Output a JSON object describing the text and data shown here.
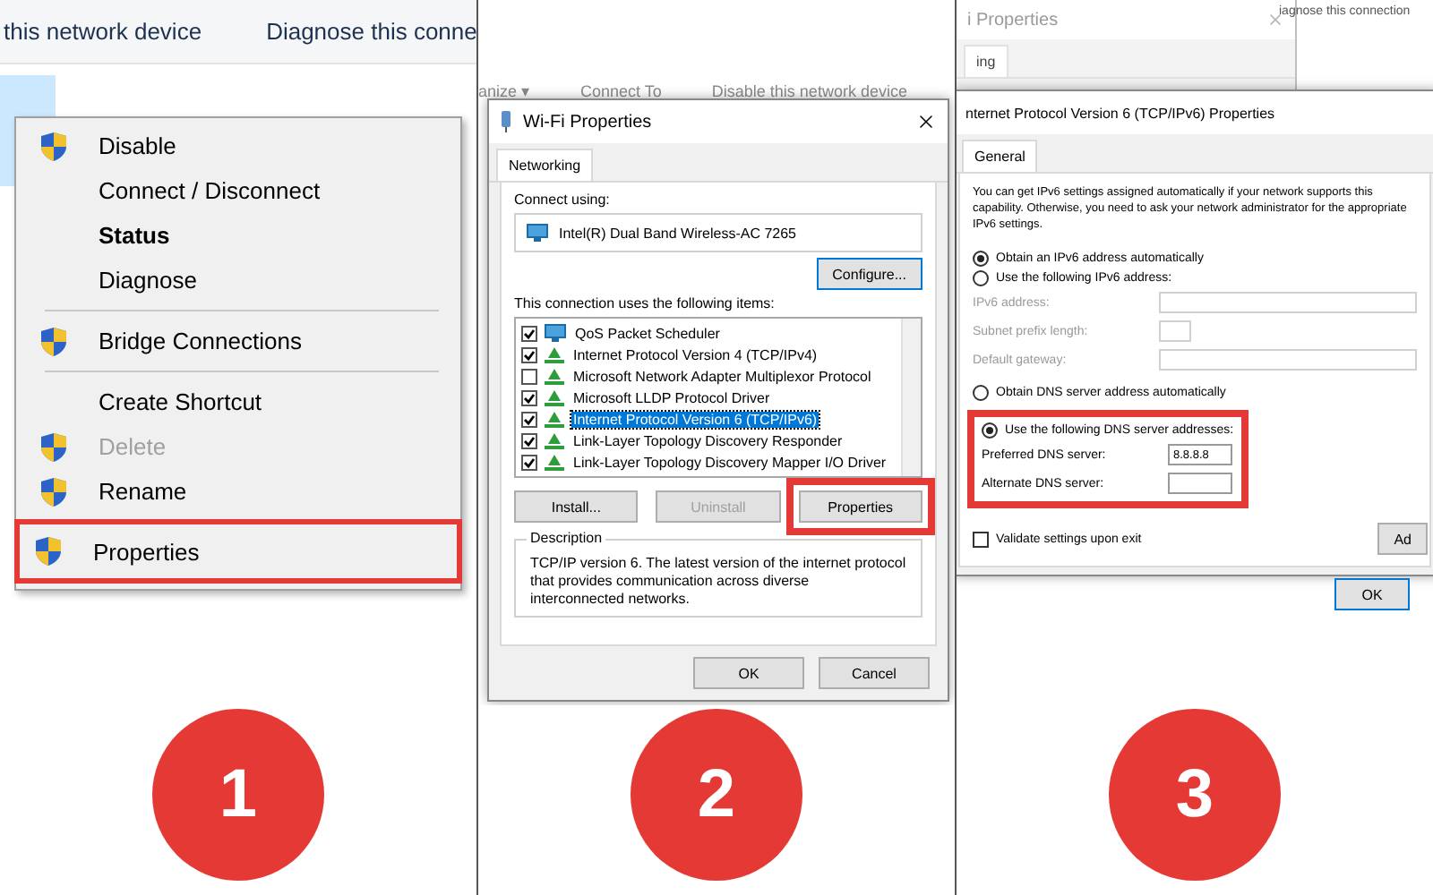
{
  "panel_1": {
    "toolbar": [
      "this network device",
      "Diagnose this conne"
    ],
    "menu": [
      {
        "kind": "item",
        "label": "Disable",
        "shield": true,
        "bold": false,
        "disabled": false,
        "highlighted": false
      },
      {
        "kind": "item",
        "label": "Connect / Disconnect",
        "shield": false,
        "bold": false,
        "disabled": false,
        "highlighted": false
      },
      {
        "kind": "item",
        "label": "Status",
        "shield": false,
        "bold": true,
        "disabled": false,
        "highlighted": false
      },
      {
        "kind": "item",
        "label": "Diagnose",
        "shield": false,
        "bold": false,
        "disabled": false,
        "highlighted": false
      },
      {
        "kind": "separator"
      },
      {
        "kind": "item",
        "label": "Bridge Connections",
        "shield": true,
        "bold": false,
        "disabled": false,
        "highlighted": false
      },
      {
        "kind": "separator"
      },
      {
        "kind": "item",
        "label": "Create Shortcut",
        "shield": false,
        "bold": false,
        "disabled": false,
        "highlighted": false
      },
      {
        "kind": "item",
        "label": "Delete",
        "shield": true,
        "bold": false,
        "disabled": true,
        "highlighted": false
      },
      {
        "kind": "item",
        "label": "Rename",
        "shield": true,
        "bold": false,
        "disabled": false,
        "highlighted": false
      },
      {
        "kind": "item",
        "label": "Properties",
        "shield": true,
        "bold": false,
        "disabled": false,
        "highlighted": true
      }
    ],
    "step": "1"
  },
  "panel_2": {
    "toolbar": [
      "anize ▾",
      "Connect To",
      "Disable this network device"
    ],
    "dialog": {
      "title": "Wi-Fi Properties",
      "tab": "Networking",
      "connect_label": "Connect using:",
      "adapter": "Intel(R) Dual Band Wireless-AC 7265",
      "configure": "Configure...",
      "items_label": "This connection uses the following items:",
      "items": [
        {
          "kind": "service",
          "label": "QoS Packet Scheduler",
          "checked": true,
          "selected": false
        },
        {
          "kind": "protocol",
          "label": "Internet Protocol Version 4 (TCP/IPv4)",
          "checked": true,
          "selected": false
        },
        {
          "kind": "protocol",
          "label": "Microsoft Network Adapter Multiplexor Protocol",
          "checked": false,
          "selected": false
        },
        {
          "kind": "protocol",
          "label": "Microsoft LLDP Protocol Driver",
          "checked": true,
          "selected": false
        },
        {
          "kind": "protocol",
          "label": "Internet Protocol Version 6 (TCP/IPv6)",
          "checked": true,
          "selected": true
        },
        {
          "kind": "protocol",
          "label": "Link-Layer Topology Discovery Responder",
          "checked": true,
          "selected": false
        },
        {
          "kind": "protocol",
          "label": "Link-Layer Topology Discovery Mapper I/O Driver",
          "checked": true,
          "selected": false
        }
      ],
      "buttons": [
        {
          "label": "Install...",
          "disabled": false,
          "highlighted": false
        },
        {
          "label": "Uninstall",
          "disabled": true,
          "highlighted": false
        },
        {
          "label": "Properties",
          "disabled": false,
          "highlighted": true
        }
      ],
      "description_title": "Description",
      "description": "TCP/IP version 6. The latest version of the internet protocol that provides communication across diverse interconnected networks.",
      "footer": [
        "OK",
        "Cancel"
      ]
    },
    "step": "2"
  },
  "panel_3": {
    "toolbar": [
      "iagnose this connection"
    ],
    "background_window": {
      "title": "i Properties",
      "tab": "ing"
    },
    "dialog": {
      "title": "nternet Protocol Version 6 (TCP/IPv6) Properties",
      "tab": "General",
      "intro": "You can get IPv6 settings assigned automatically if your network supports this capability. Otherwise, you need to ask your network administrator for the appropriate IPv6 settings.",
      "address_options": [
        {
          "label": "Obtain an IPv6 address automatically",
          "selected": true
        },
        {
          "label": "Use the following IPv6 address:",
          "selected": false
        }
      ],
      "address_fields": [
        {
          "label": "IPv6 address:",
          "kind": "wide",
          "disabled": true
        },
        {
          "label": "Subnet prefix length:",
          "kind": "short",
          "disabled": true
        },
        {
          "label": "Default gateway:",
          "kind": "wide",
          "disabled": true
        }
      ],
      "dns_options": [
        {
          "label": "Obtain DNS server address automatically",
          "selected": false
        },
        {
          "label": "Use the following DNS server addresses:",
          "selected": true
        }
      ],
      "dns_fields": [
        {
          "label": "Preferred DNS server:",
          "value": "8.8.8.8",
          "disabled": false
        },
        {
          "label": "Alternate DNS server:",
          "disabled": false
        }
      ],
      "dns_highlighted": true,
      "validate": {
        "label": "Validate settings upon exit",
        "checked": false
      },
      "advanced": "Ad",
      "ok": "OK"
    },
    "step": "3"
  }
}
